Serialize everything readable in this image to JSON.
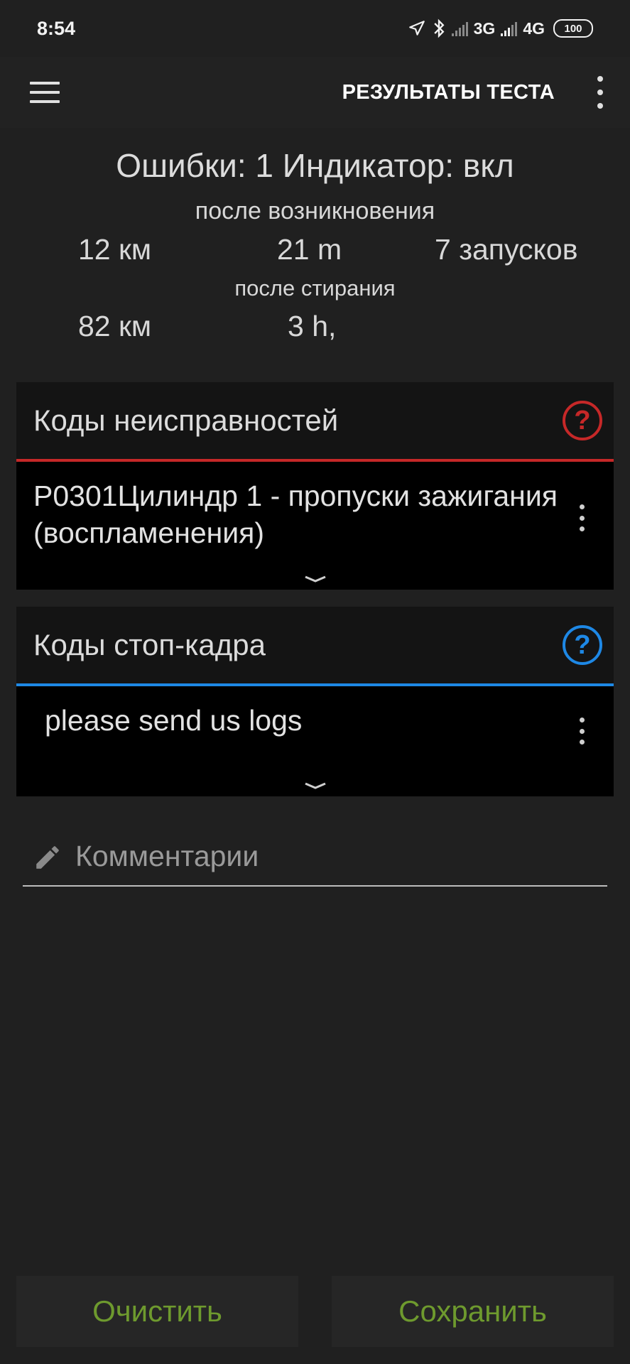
{
  "status_bar": {
    "time": "8:54",
    "net1": "3G",
    "net2": "4G",
    "battery": "100"
  },
  "app_bar": {
    "title": "РЕЗУЛЬТАТЫ ТЕСТА",
    "menu_icon": "hamburger-icon",
    "overflow_icon": "more-vert-icon"
  },
  "summary": {
    "headline": "Ошибки: 1 Индикатор: вкл",
    "since_occurrence_label": "после возникновения",
    "since_occurrence": {
      "distance": "12 км",
      "time": "21 m",
      "starts": "7 запусков"
    },
    "since_clear_label": "после стирания",
    "since_clear": {
      "distance": "82 км",
      "time": "3 h,"
    }
  },
  "dtc_card": {
    "title": "Коды неисправностей",
    "accent": "#c62828",
    "items": [
      "P0301Цилиндр 1 - пропуски зажигания (воспламенения)"
    ]
  },
  "freeze_card": {
    "title": "Коды стоп-кадра",
    "accent": "#1e88e5",
    "items": [
      "please send us logs"
    ]
  },
  "comment": {
    "placeholder": "Комментарии"
  },
  "buttons": {
    "clear": "Очистить",
    "save": "Сохранить",
    "accent": "#6e9a2e"
  }
}
